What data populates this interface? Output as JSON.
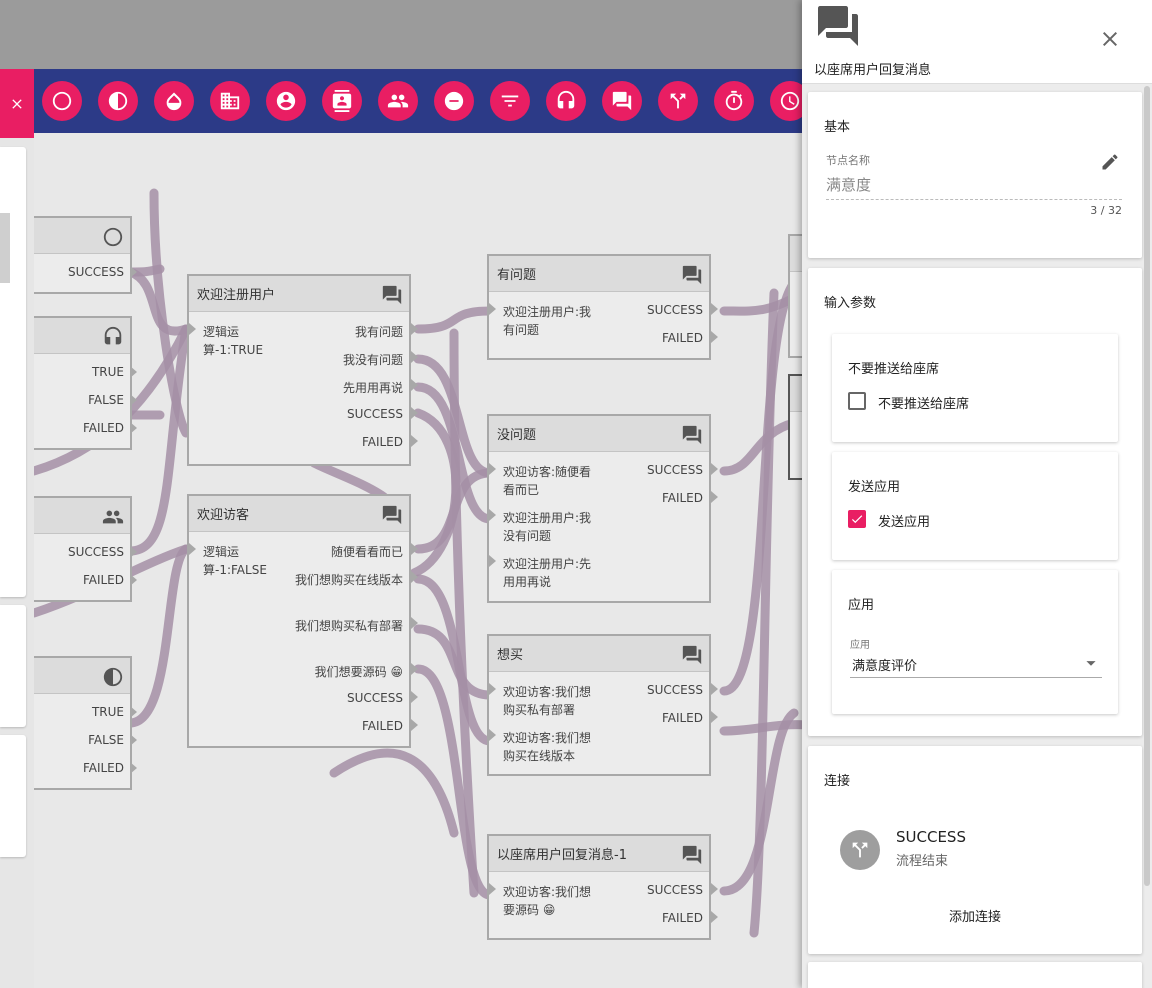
{
  "left_panel": {
    "close_icon": "close-icon"
  },
  "toolbar": {
    "buttons": [
      "circle-icon",
      "contrast-icon",
      "drop-icon",
      "building-icon",
      "account-circle-icon",
      "contact-card-icon",
      "group-icon",
      "minus-circle-icon",
      "filter-icon",
      "headset-icon",
      "forum-icon",
      "call-split-icon",
      "timer-icon",
      "clock-icon"
    ]
  },
  "canvas": {
    "node_a": {
      "port": "SUCCESS"
    },
    "node_b": {
      "ports": [
        "TRUE",
        "FALSE",
        "FAILED"
      ]
    },
    "node_c": {
      "ports": [
        "SUCCESS",
        "FAILED"
      ]
    },
    "node_d": {
      "ports": [
        "TRUE",
        "FALSE",
        "FAILED"
      ]
    },
    "welcome_registered": {
      "title": "欢迎注册用户",
      "input": "逻辑运算-1:TRUE",
      "ports": [
        "我有问题",
        "我没有问题",
        "先用用再说",
        "SUCCESS",
        "FAILED"
      ]
    },
    "welcome_visitor": {
      "title": "欢迎访客",
      "input": "逻辑运算-1:FALSE",
      "ports": [
        "随便看看而已",
        "我们想购买在线版本",
        "我们想购买私有部署",
        "我们想要源码 😁",
        "SUCCESS",
        "FAILED"
      ]
    },
    "has_question": {
      "title": "有问题",
      "inputs": [
        "欢迎注册用户:我有问题"
      ],
      "ports": [
        "SUCCESS",
        "FAILED"
      ]
    },
    "no_question": {
      "title": "没问题",
      "inputs": [
        "欢迎访客:随便看看而已",
        "欢迎注册用户:我没有问题",
        "欢迎注册用户:先用用再说"
      ],
      "ports": [
        "SUCCESS",
        "FAILED"
      ]
    },
    "want_buy": {
      "title": "想买",
      "inputs": [
        "欢迎访客:我们想购买私有部署",
        "欢迎访客:我们想购买在线版本"
      ],
      "ports": [
        "SUCCESS",
        "FAILED"
      ]
    },
    "agent_reply": {
      "title": "以座席用户回复消息-1",
      "inputs": [
        "欢迎访客:我们想要源码 😁"
      ],
      "ports": [
        "SUCCESS",
        "FAILED"
      ]
    }
  },
  "right_panel": {
    "title": "以座席用户回复消息",
    "basic": {
      "heading": "基本",
      "field_label": "节点名称",
      "field_value": "满意度",
      "counter": "3 / 32"
    },
    "params": {
      "heading": "输入参数",
      "no_push": {
        "title": "不要推送给座席",
        "checkbox_label": "不要推送给座席",
        "checked": false
      },
      "send_app": {
        "title": "发送应用",
        "checkbox_label": "发送应用",
        "checked": true
      },
      "app": {
        "title": "应用",
        "select_label": "应用",
        "select_value": "满意度评价"
      }
    },
    "connections": {
      "heading": "连接",
      "items": [
        {
          "name": "SUCCESS",
          "target": "流程结束"
        }
      ],
      "add_label": "添加连接"
    }
  },
  "colors": {
    "accent": "#e91e63",
    "toolbar": "#2c3a87",
    "wire": "#a48fa6"
  }
}
